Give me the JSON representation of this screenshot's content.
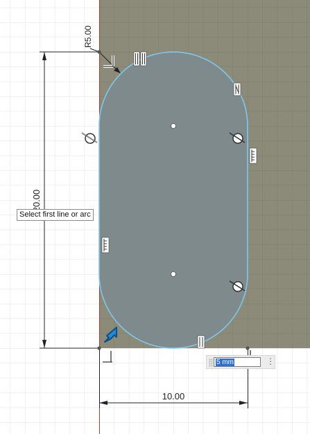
{
  "sketch": {
    "radius_label": "R5.00",
    "height_label": "20.00",
    "width_label": "10.00",
    "tooltip": "Select first line or arc"
  },
  "dimension_input": {
    "value_selected": "5 mm",
    "more_icon": "more-vertical-icon"
  },
  "colors": {
    "grid_line": "#e3e3e3",
    "plane_fill": "#8c8a78",
    "profile_fill": "#7d8a8c",
    "profile_stroke": "#7ec8f0",
    "dimension_line": "#222222",
    "axis_red": "#c0392b",
    "cursor_blue": "#1f8ad6"
  },
  "icons": [
    "parallel-constraint-icon",
    "tangent-constraint-icon",
    "equal-constraint-icon",
    "perpendicular-constraint-icon",
    "coincident-constraint-icon",
    "select-cursor-icon"
  ]
}
